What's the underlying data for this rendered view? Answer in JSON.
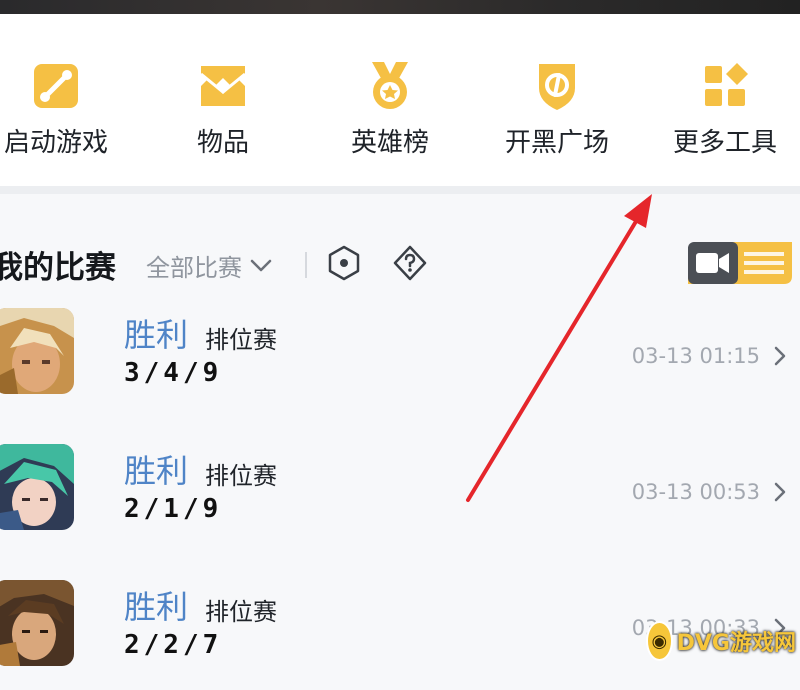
{
  "toolbar": {
    "items": [
      {
        "label": "启动游戏",
        "icon": "launch-game-icon"
      },
      {
        "label": "物品",
        "icon": "items-icon"
      },
      {
        "label": "英雄榜",
        "icon": "hero-ranking-medal-icon"
      },
      {
        "label": "开黑广场",
        "icon": "team-square-shield-icon"
      },
      {
        "label": "更多工具",
        "icon": "more-tools-grid-icon"
      }
    ]
  },
  "matches_section": {
    "title": "我的比赛",
    "filter_label": "全部比赛",
    "icons": [
      "hexagon-icon",
      "help-diamond-icon",
      "video-record-icon"
    ]
  },
  "matches": [
    {
      "result": "胜利",
      "mode": "排位赛",
      "kda": "3/4/9",
      "time": "03-13 01:15"
    },
    {
      "result": "胜利",
      "mode": "排位赛",
      "kda": "2/1/9",
      "time": "03-13 00:53"
    },
    {
      "result": "胜利",
      "mode": "排位赛",
      "kda": "2/2/7",
      "time": "03-13 00:33"
    }
  ],
  "watermark": {
    "text": "DVG游戏网"
  },
  "colors": {
    "accent_yellow": "#f5c044",
    "win_blue": "#4f84c7",
    "arrow_red": "#e5262b"
  }
}
